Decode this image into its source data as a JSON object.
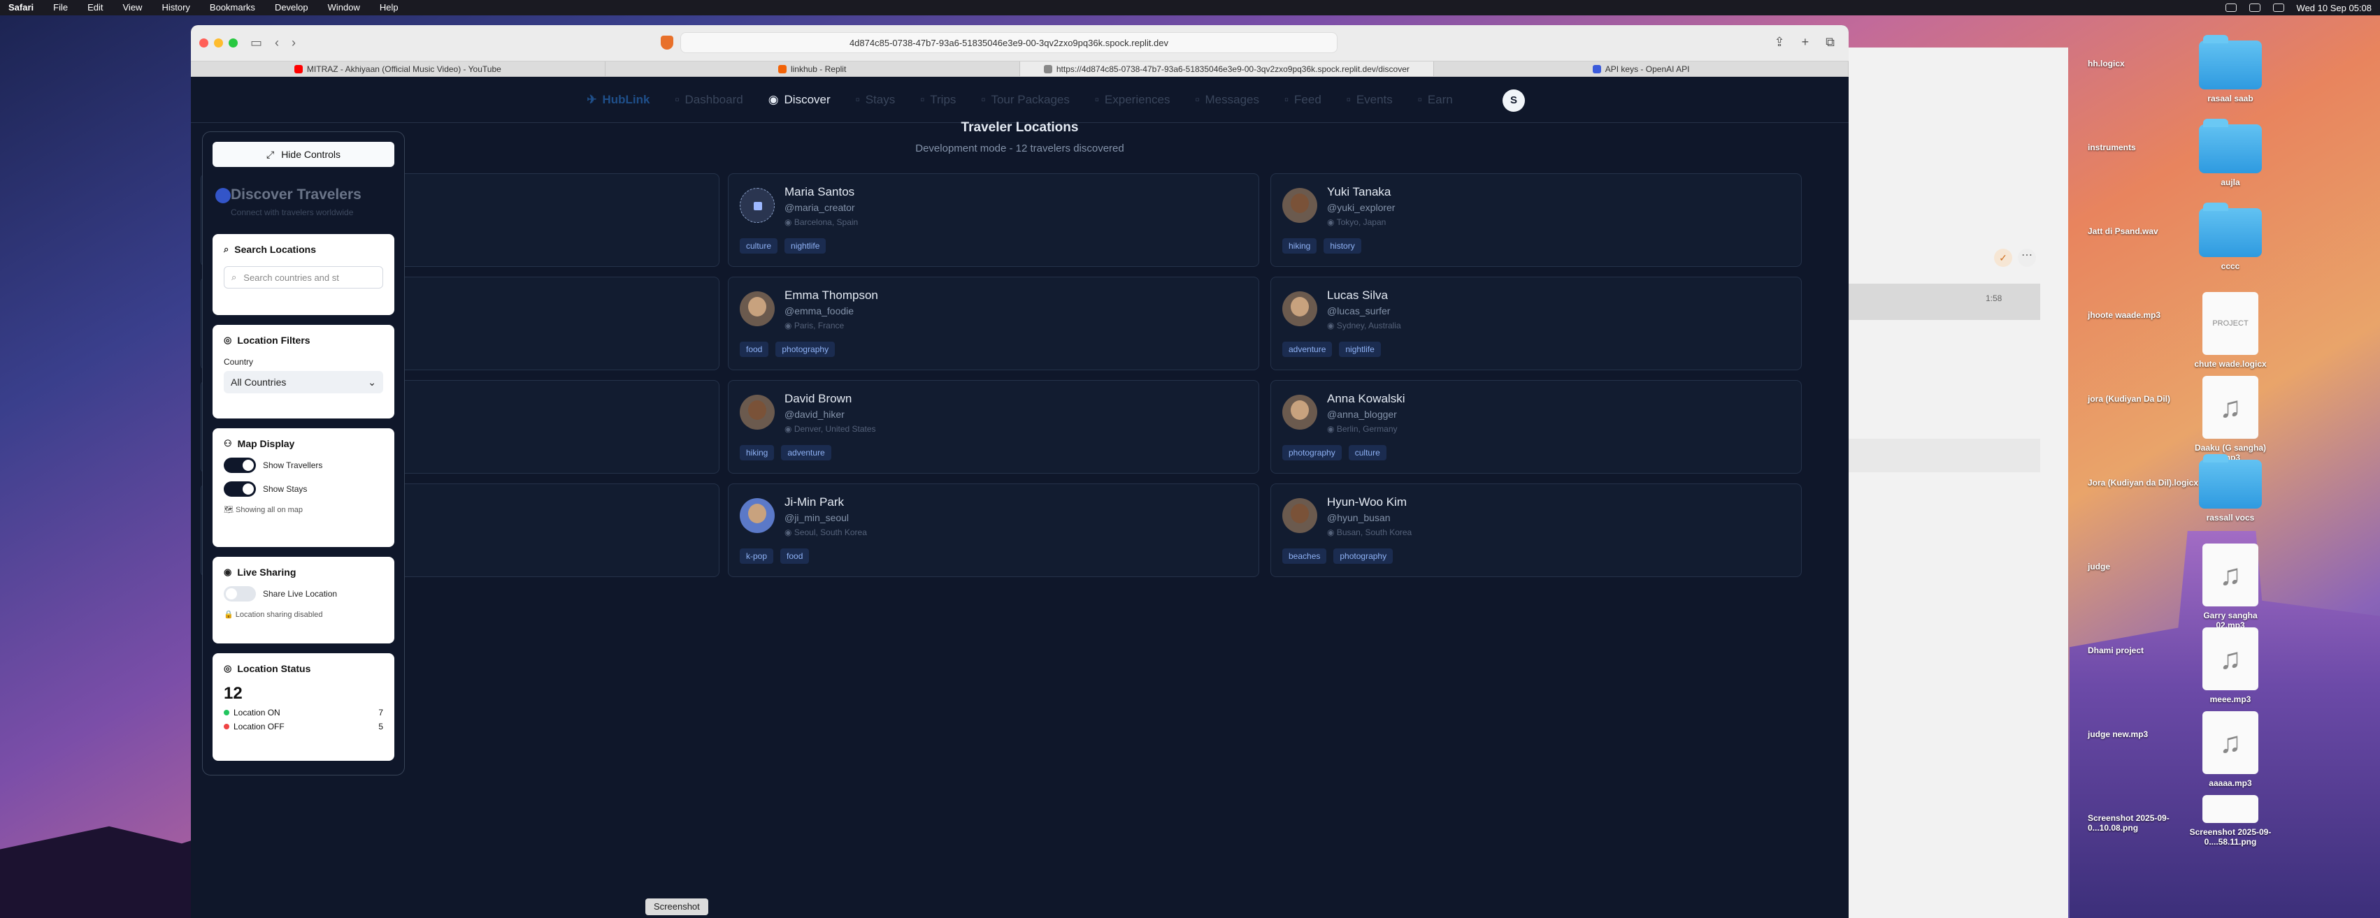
{
  "menubar": {
    "items": [
      "Safari",
      "File",
      "Edit",
      "View",
      "History",
      "Bookmarks",
      "Develop",
      "Window",
      "Help"
    ],
    "clock": "Wed 10 Sep 05:08"
  },
  "browser": {
    "url": "4d874c85-0738-47b7-93a6-51835046e3e9-00-3qv2zxo9pq36k.spock.replit.dev",
    "tabs": [
      {
        "label": "MITRAZ - Akhiyaan (Official Music Video) - YouTube",
        "favicon_color": "#ff0000"
      },
      {
        "label": "linkhub - Replit",
        "favicon_color": "#f26207"
      },
      {
        "label": "https://4d874c85-0738-47b7-93a6-51835046e3e9-00-3qv2zxo9pq36k.spock.replit.dev/discover",
        "favicon_color": "#888888"
      },
      {
        "label": "API keys - OpenAI API",
        "favicon_color": "#3b5bdb"
      }
    ]
  },
  "app": {
    "brand": "HubLink",
    "nav": [
      "Dashboard",
      "Discover",
      "Stays",
      "Trips",
      "Tour Packages",
      "Experiences",
      "Messages",
      "Feed",
      "Events",
      "Earn"
    ],
    "active_nav": "Discover",
    "user_initial": "S",
    "page_title": "Traveler Locations",
    "page_subtitle": "Development mode - 12 travelers discovered",
    "travelers": [
      {
        "name": "Maria Santos",
        "handle": "@maria_creator",
        "location": "Barcelona, Spain",
        "tags": [
          "culture",
          "nightlife"
        ],
        "avatar": "pattern"
      },
      {
        "name": "Yuki Tanaka",
        "handle": "@yuki_explorer",
        "location": "Tokyo, Japan",
        "tags": [
          "hiking",
          "history"
        ],
        "avatar": "dark"
      },
      {
        "name": "Emma Thompson",
        "handle": "@emma_foodie",
        "location": "Paris, France",
        "tags": [
          "food",
          "photography"
        ],
        "avatar": "light"
      },
      {
        "name": "Lucas Silva",
        "handle": "@lucas_surfer",
        "location": "Sydney, Australia",
        "tags": [
          "adventure",
          "nightlife"
        ],
        "avatar": "light"
      },
      {
        "name": "David Brown",
        "handle": "@david_hiker",
        "location": "Denver, United States",
        "tags": [
          "hiking",
          "adventure"
        ],
        "avatar": "dark"
      },
      {
        "name": "Anna Kowalski",
        "handle": "@anna_blogger",
        "location": "Berlin, Germany",
        "tags": [
          "photography",
          "culture"
        ],
        "avatar": "light"
      },
      {
        "name": "Ji-Min Park",
        "handle": "@ji_min_seoul",
        "location": "Seoul, South Korea",
        "tags": [
          "k-pop",
          "food"
        ],
        "avatar": "blue"
      },
      {
        "name": "Hyun-Woo Kim",
        "handle": "@hyun_busan",
        "location": "Busan, South Korea",
        "tags": [
          "beaches",
          "photography"
        ],
        "avatar": "dark"
      }
    ]
  },
  "controls": {
    "hide_label": "Hide Controls",
    "title": "Discover Travelers",
    "subtitle": "Connect with travelers worldwide",
    "search": {
      "heading": "Search Locations",
      "placeholder": "Search countries and st"
    },
    "filters": {
      "heading": "Location Filters",
      "country_label": "Country",
      "country_value": "All Countries"
    },
    "map_display": {
      "heading": "Map Display",
      "show_travellers": "Show Travellers",
      "show_stays": "Show Stays",
      "note": "Showing all on map"
    },
    "live": {
      "heading": "Live Sharing",
      "share_label": "Share Live Location",
      "note": "Location sharing disabled"
    },
    "status": {
      "heading": "Location Status",
      "total": "12",
      "on_label": "Location ON",
      "on_count": "7",
      "off_label": "Location OFF",
      "off_count": "5",
      "on_color": "#22c55e",
      "off_color": "#ef4444"
    }
  },
  "desktop": {
    "items": [
      {
        "label": "hh.logicx",
        "kind": "plain"
      },
      {
        "label": "rasaal saab",
        "kind": "folder"
      },
      {
        "label": "instruments",
        "kind": "plain"
      },
      {
        "label": "aujla",
        "kind": "folder"
      },
      {
        "label": "Jatt di Psand.wav",
        "kind": "plain"
      },
      {
        "label": "cccc",
        "kind": "folder"
      },
      {
        "label": "jhoote waade.mp3",
        "kind": "plain"
      },
      {
        "label": "chute wade.logicx",
        "kind": "project"
      },
      {
        "label": "jora (Kudiyan Da Dil)",
        "kind": "plain"
      },
      {
        "label": "Daaku (G sangha) .mp3",
        "kind": "file"
      },
      {
        "label": "Jora (Kudiyan da Dil).logicx",
        "kind": "plain"
      },
      {
        "label": "rassall vocs",
        "kind": "folder"
      },
      {
        "label": "judge",
        "kind": "plain"
      },
      {
        "label": "Garry sangha 02.mp3",
        "kind": "file"
      },
      {
        "label": "Dhami project",
        "kind": "plain"
      },
      {
        "label": "meee.mp3",
        "kind": "file"
      },
      {
        "label": "judge new.mp3",
        "kind": "plain"
      },
      {
        "label": "aaaaa.mp3",
        "kind": "file"
      },
      {
        "label": "Screenshot 2025-09-0...10.08.png",
        "kind": "plain"
      },
      {
        "label": "Screenshot 2025-09-0....58.11.png",
        "kind": "shot"
      }
    ],
    "project_badge": "PROJECT",
    "bg_time": "1:58"
  },
  "screenshot_label": "Screenshot"
}
